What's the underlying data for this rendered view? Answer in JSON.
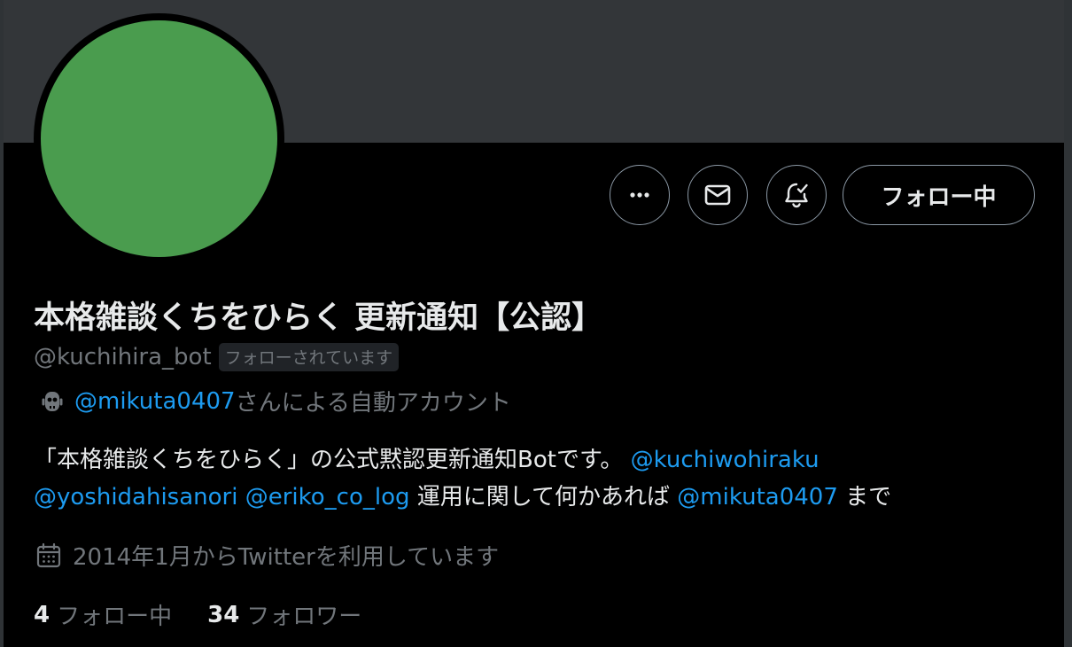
{
  "profile": {
    "display_name": "本格雑談くちをひらく 更新通知【公認】",
    "handle": "@kuchihira_bot",
    "follows_you_badge": "フォローされています",
    "automated": {
      "owner_mention": "@mikuta0407",
      "suffix": "さんによる自動アカウント"
    },
    "bio": {
      "line1_text": "「本格雑談くちをひらく」の公式黙認更新通知Botです。",
      "mention1": "@kuchiwohiraku",
      "mention2": "@yoshidahisanori",
      "mention3": "@eriko_co_log",
      "line2_text": "運用に関して何かあれば",
      "mention4": "@mikuta0407",
      "line2_end": "まで"
    },
    "joined": "2014年1月からTwitterを利用しています",
    "stats": {
      "following_count": "4",
      "following_label": "フォロー中",
      "followers_count": "34",
      "followers_label": "フォロワー"
    }
  },
  "actions": {
    "more_icon": "more-horizontal-icon",
    "message_icon": "envelope-icon",
    "notify_icon": "bell-check-icon",
    "follow_label": "フォロー中"
  },
  "colors": {
    "background": "#000000",
    "banner": "#333639",
    "avatar": "#4a9c4e",
    "link": "#1d9bf0",
    "muted": "#71767b"
  }
}
